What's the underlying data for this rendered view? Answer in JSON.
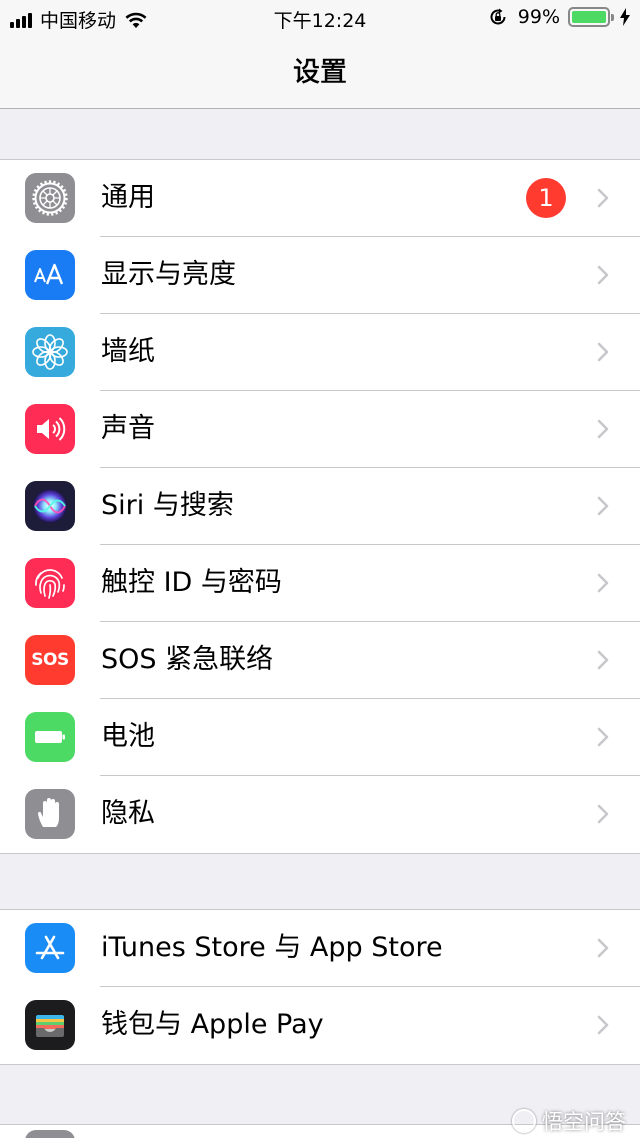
{
  "status_bar": {
    "carrier": "中国移动",
    "time": "下午12:24",
    "battery_percent": "99%",
    "battery_level": 0.99,
    "icons": [
      "signal-icon",
      "wifi-icon",
      "orientation-lock-icon",
      "battery-icon",
      "charging-icon"
    ]
  },
  "nav": {
    "title": "设置"
  },
  "groups": [
    {
      "items": [
        {
          "label": "通用",
          "icon": "gear-icon",
          "color": "#8e8e93",
          "badge": "1"
        },
        {
          "label": "显示与亮度",
          "icon": "text-size-icon",
          "color": "#1a7cf5"
        },
        {
          "label": "墙纸",
          "icon": "flower-icon",
          "color": "#36aadc"
        },
        {
          "label": "声音",
          "icon": "speaker-icon",
          "color": "#ff2d55"
        },
        {
          "label": "Siri 与搜索",
          "icon": "siri-icon",
          "color": "#1d1d3a"
        },
        {
          "label": "触控 ID 与密码",
          "icon": "fingerprint-icon",
          "color": "#ff2d55"
        },
        {
          "label": "SOS 紧急联络",
          "icon": "sos-icon",
          "color": "#ff3b30",
          "icon_text": "SOS"
        },
        {
          "label": "电池",
          "icon": "battery-icon",
          "color": "#4cd964"
        },
        {
          "label": "隐私",
          "icon": "hand-icon",
          "color": "#8e8e93"
        }
      ]
    },
    {
      "items": [
        {
          "label": "iTunes Store 与 App Store",
          "icon": "app-store-icon",
          "color": "#1a8cf5"
        },
        {
          "label": "钱包与 Apple Pay",
          "icon": "wallet-icon",
          "color": "#1c1c1e"
        }
      ]
    }
  ],
  "watermark": "悟空问答"
}
